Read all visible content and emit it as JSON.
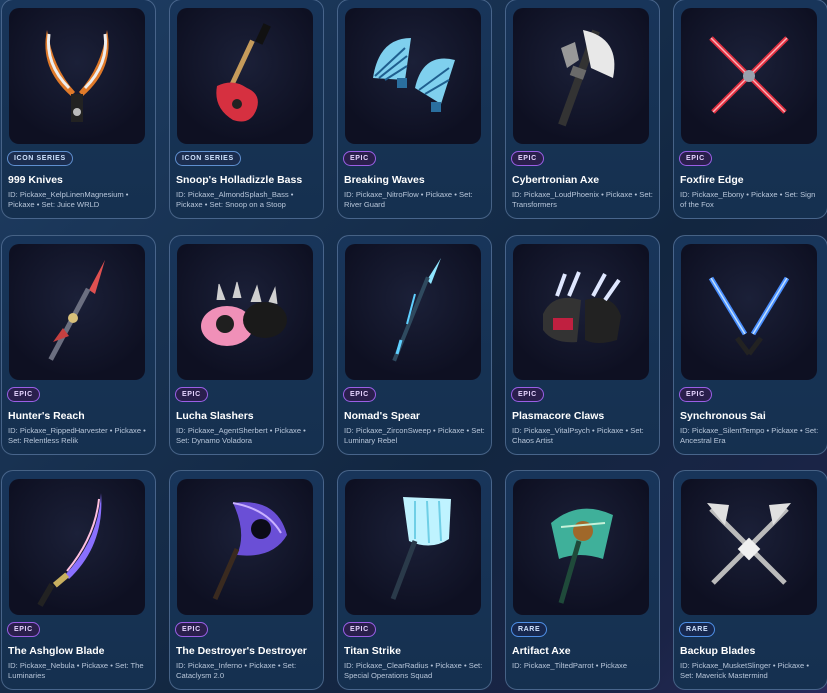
{
  "colors": {
    "icon_series": "#5f8fcf",
    "epic": "#9b5fe6",
    "rare": "#4f8fe6"
  },
  "items": [
    {
      "name": "999 Knives",
      "rarity": "ICON SERIES",
      "meta": "ID: Pickaxe_KelpLinenMagnesium • Pickaxe • Set: Juice WRLD",
      "icon": "dual-curved-knives-icon"
    },
    {
      "name": "Snoop's Holladizzle Bass",
      "rarity": "ICON SERIES",
      "meta": "ID: Pickaxe_AlmondSplash_Bass • Pickaxe • Set: Snoop on a Stoop",
      "icon": "bass-guitar-icon"
    },
    {
      "name": "Breaking Waves",
      "rarity": "EPIC",
      "meta": "ID: Pickaxe_NitroFlow • Pickaxe • Set: River Guard",
      "icon": "fan-blades-icon"
    },
    {
      "name": "Cybertronian Axe",
      "rarity": "EPIC",
      "meta": "ID: Pickaxe_LoudPhoenix • Pickaxe • Set: Transformers",
      "icon": "robot-axe-icon"
    },
    {
      "name": "Foxfire Edge",
      "rarity": "EPIC",
      "meta": "ID: Pickaxe_Ebony • Pickaxe • Set: Sign of the Fox",
      "icon": "crossed-red-blades-icon"
    },
    {
      "name": "Hunter's Reach",
      "rarity": "EPIC",
      "meta": "ID: Pickaxe_RippedHarvester • Pickaxe • Set: Relentless Relik",
      "icon": "spear-icon"
    },
    {
      "name": "Lucha Slashers",
      "rarity": "EPIC",
      "meta": "ID: Pickaxe_AgentSherbert • Pickaxe • Set: Dynamo Voladora",
      "icon": "spiked-gloves-icon"
    },
    {
      "name": "Nomad's Spear",
      "rarity": "EPIC",
      "meta": "ID: Pickaxe_ZirconSweep • Pickaxe • Set: Luminary Rebel",
      "icon": "glowing-spear-icon"
    },
    {
      "name": "Plasmacore Claws",
      "rarity": "EPIC",
      "meta": "ID: Pickaxe_VitalPsych • Pickaxe • Set: Chaos Artist",
      "icon": "claw-gauntlets-icon"
    },
    {
      "name": "Synchronous Sai",
      "rarity": "EPIC",
      "meta": "ID: Pickaxe_SilentTempo • Pickaxe • Set: Ancestral Era",
      "icon": "dual-sai-icon"
    },
    {
      "name": "The Ashglow Blade",
      "rarity": "EPIC",
      "meta": "ID: Pickaxe_Nebula • Pickaxe • Set: The Luminaries",
      "icon": "katana-icon"
    },
    {
      "name": "The Destroyer's Destroyer",
      "rarity": "EPIC",
      "meta": "ID: Pickaxe_Inferno • Pickaxe • Set: Cataclysm 2.0",
      "icon": "void-axe-icon"
    },
    {
      "name": "Titan Strike",
      "rarity": "EPIC",
      "meta": "ID: Pickaxe_ClearRadius • Pickaxe • Set: Special Operations Squad",
      "icon": "crystal-fist-icon"
    },
    {
      "name": "Artifact Axe",
      "rarity": "RARE",
      "meta": "ID: Pickaxe_TiltedParrot • Pickaxe",
      "icon": "artifact-axe-icon"
    },
    {
      "name": "Backup Blades",
      "rarity": "RARE",
      "meta": "ID: Pickaxe_MusketSlinger • Pickaxe • Set: Maverick Mastermind",
      "icon": "crossed-axes-icon"
    }
  ]
}
